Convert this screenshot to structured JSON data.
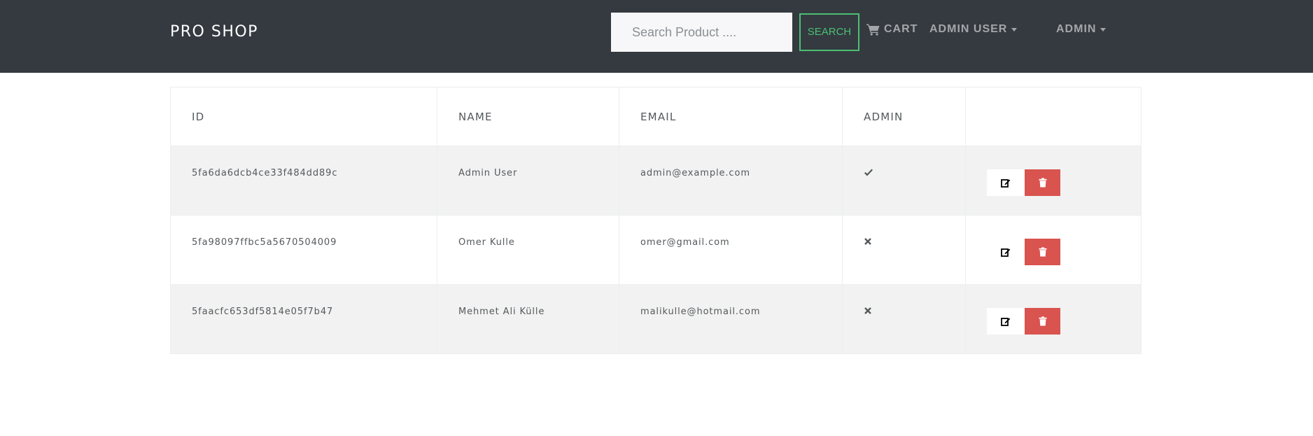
{
  "navbar": {
    "brand": "PRO SHOP",
    "search": {
      "placeholder": "Search Product ....",
      "value": "",
      "button_label": "SEARCH"
    },
    "cart_label": "CART",
    "user_menu_label": "ADMIN USER",
    "admin_menu_label": "ADMIN",
    "icons": {
      "cart": "cart-icon",
      "dropdown": "caret-down-icon"
    }
  },
  "colors": {
    "navbar_bg": "#343a40",
    "accent_green": "#4bbf73",
    "delete_red": "#d9534f",
    "stripe": "#f2f2f2"
  },
  "users_table": {
    "columns": [
      "ID",
      "NAME",
      "EMAIL",
      "ADMIN",
      ""
    ],
    "rows": [
      {
        "id": "5fa6da6dcb4ce33f484dd89c",
        "name": "Admin User",
        "email": "admin@example.com",
        "is_admin": true,
        "admin_icon": "check-icon"
      },
      {
        "id": "5fa98097ffbc5a5670504009",
        "name": "Omer Kulle",
        "email": "omer@gmail.com",
        "is_admin": false,
        "admin_icon": "times-icon"
      },
      {
        "id": "5faacfc653df5814e05f7b47",
        "name": "Mehmet Ali Külle",
        "email": "malikulle@hotmail.com",
        "is_admin": false,
        "admin_icon": "times-icon"
      }
    ],
    "row_actions": {
      "edit_icon": "edit-icon",
      "delete_icon": "trash-icon"
    }
  }
}
